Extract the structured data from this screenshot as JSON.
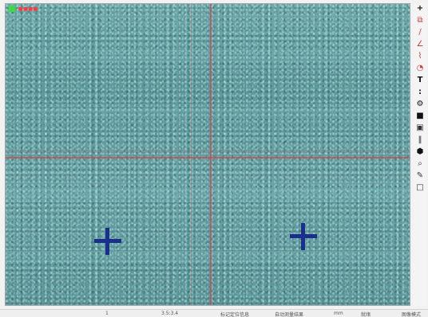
{
  "viewport": {
    "corner_label": "■■■■",
    "indicator_color": "#3fdc3f",
    "cursor_color": "#c84650",
    "marker_color": "#1a2f8c"
  },
  "toolbar": {
    "items": [
      {
        "name": "crosshair-tool-icon",
        "glyph": "+"
      },
      {
        "name": "measure-rect-tool-icon",
        "glyph": "⧉"
      },
      {
        "name": "line-tool-icon",
        "glyph": "∕"
      },
      {
        "name": "angle-tool-icon",
        "glyph": "∠"
      },
      {
        "name": "polyline-tool-icon",
        "glyph": "⌇"
      },
      {
        "name": "arc-tool-icon",
        "glyph": "◔"
      },
      {
        "name": "text-tool-icon",
        "glyph": "T"
      },
      {
        "name": "dots-tool-icon",
        "glyph": ":"
      },
      {
        "name": "settings-gear-icon",
        "glyph": "⚙"
      },
      {
        "name": "fill-square-tool-icon",
        "glyph": "■"
      },
      {
        "name": "image-tool-icon",
        "glyph": "▣"
      },
      {
        "name": "columns-tool-icon",
        "glyph": "‖"
      },
      {
        "name": "hexagon-tool-icon",
        "glyph": "⬢"
      },
      {
        "name": "zoom-tool-icon",
        "glyph": "⌕"
      },
      {
        "name": "brush-tool-icon",
        "glyph": "✎"
      },
      {
        "name": "frame-tool-icon",
        "glyph": "□"
      }
    ]
  },
  "status": {
    "item1": "1",
    "item2": "3.5:3.4",
    "item3": "标记定位信息",
    "item4": "自动测量结果",
    "item5": "mm",
    "item6": "就绪",
    "item7": "图像模式"
  }
}
